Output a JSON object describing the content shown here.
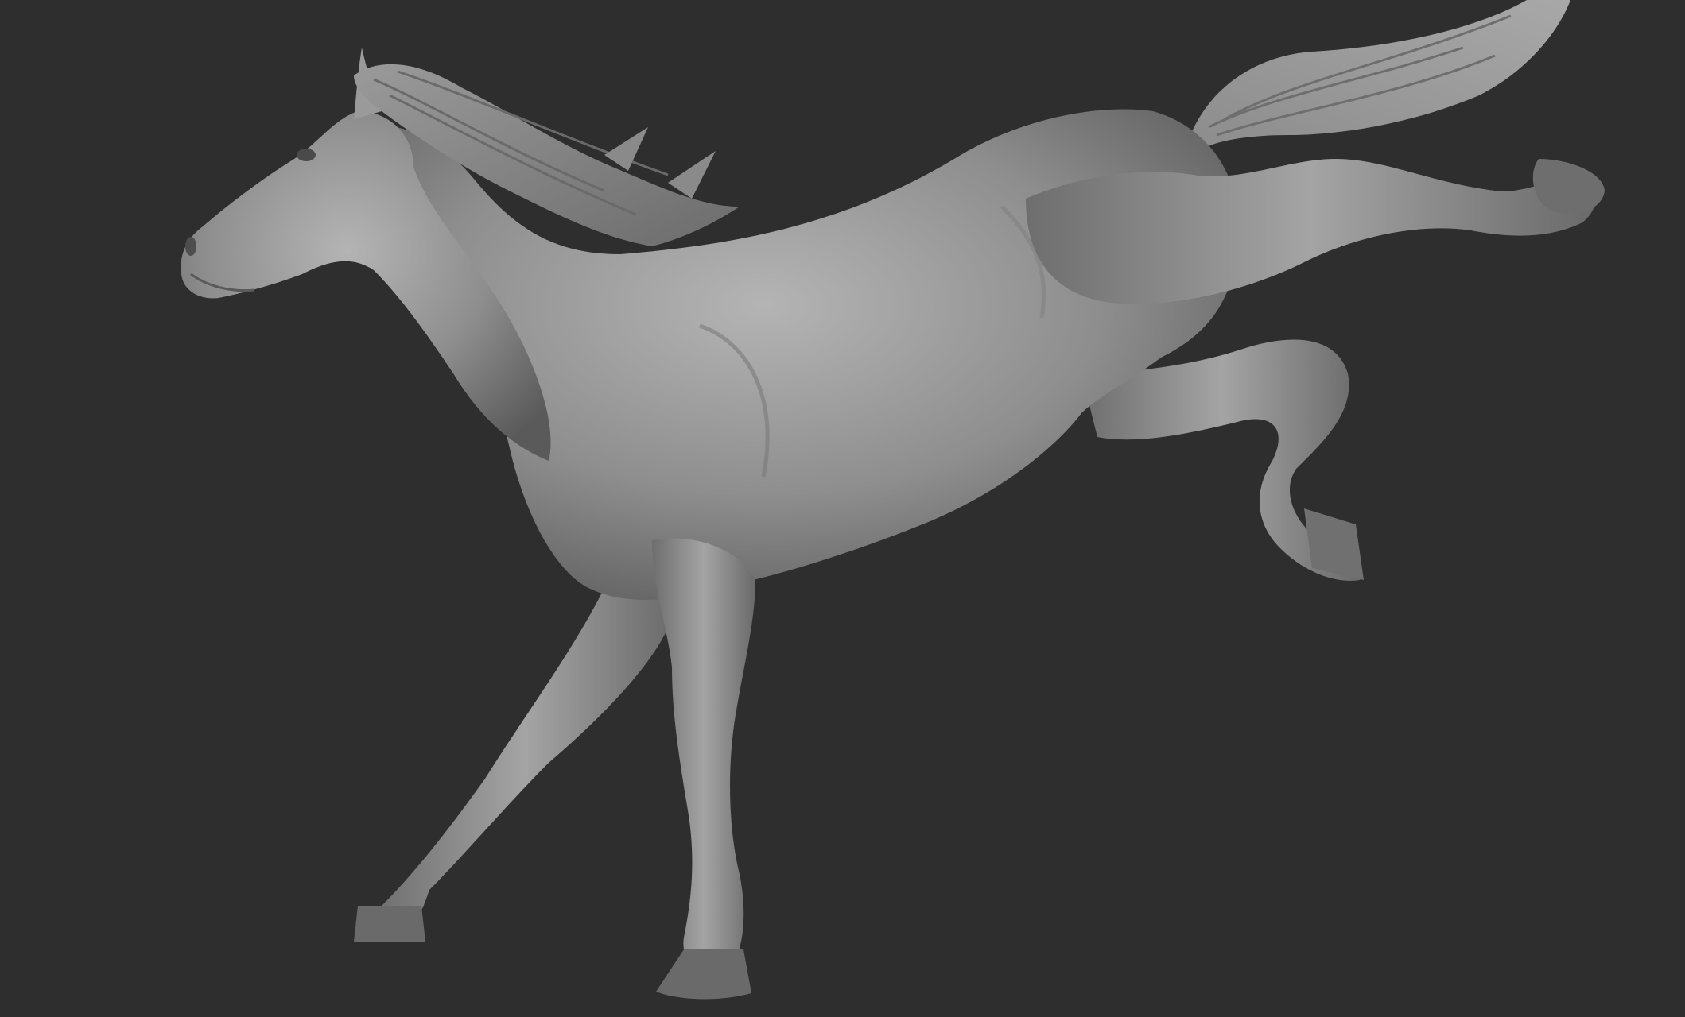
{
  "viewport": {
    "background_color": "#2e2e2e",
    "subject": "horse-sculpt",
    "material_color": "#8a8a8a"
  }
}
